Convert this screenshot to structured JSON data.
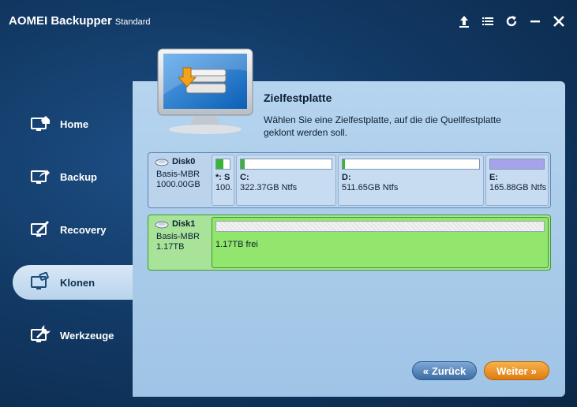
{
  "app": {
    "title": "AOMEI Backupper",
    "edition": "Standard"
  },
  "window_controls": {
    "upgrade_icon": "arrow-up-icon",
    "menu_icon": "list-menu-icon",
    "refresh_icon": "refresh-icon",
    "minimize_icon": "minimize-icon",
    "close_icon": "close-icon"
  },
  "sidebar": {
    "items": [
      {
        "label": "Home",
        "icon": "home-icon",
        "active": false
      },
      {
        "label": "Backup",
        "icon": "backup-icon",
        "active": false
      },
      {
        "label": "Recovery",
        "icon": "recovery-icon",
        "active": false
      },
      {
        "label": "Klonen",
        "icon": "clone-icon",
        "active": true
      },
      {
        "label": "Werkzeuge",
        "icon": "tools-icon",
        "active": false
      }
    ]
  },
  "main": {
    "heading": "Zielfestplatte",
    "description": "Wählen Sie eine Zielfestplatte, auf die die Quellfestplatte geklont werden soll."
  },
  "disks": [
    {
      "name": "Disk0",
      "type": "Basis-MBR",
      "size": "1000.00GB",
      "selected": false,
      "partitions": [
        {
          "label": "*: S",
          "size": "100.",
          "used_fraction": 0.55,
          "fill_color": "#3bb33b"
        },
        {
          "label": "C:",
          "size": "322.37GB Ntfs",
          "used_fraction": 0.04,
          "fill_color": "#3bb33b"
        },
        {
          "label": "D:",
          "size": "511.65GB Ntfs",
          "used_fraction": 0.02,
          "fill_color": "#3bb33b"
        },
        {
          "label": "E:",
          "size": "165.88GB Ntfs",
          "used_fraction": 1.0,
          "fill_color": "#a6a3ea"
        }
      ]
    },
    {
      "name": "Disk1",
      "type": "Basis-MBR",
      "size": "1.17TB",
      "selected": true,
      "partitions": [
        {
          "label": "",
          "size": "1.17TB frei",
          "used_fraction": 0.0,
          "fill_color": "#ffffff"
        }
      ]
    }
  ],
  "buttons": {
    "back": "Zurück",
    "next": "Weiter"
  },
  "colors": {
    "accent_next": "#e8890f",
    "accent_back": "#4f7fb6",
    "selected_disk": "#a9e39a"
  }
}
